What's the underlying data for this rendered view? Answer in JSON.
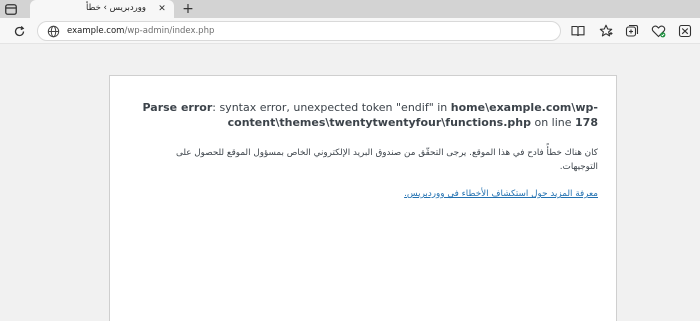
{
  "tab": {
    "title": "ووردبريس › خطأ",
    "close_glyph": "✕",
    "new_tab_glyph": "+"
  },
  "toolbar": {
    "url_host": "example.com",
    "url_path": "/wp-admin/index.php"
  },
  "error": {
    "label": "Parse error",
    "message_pre": ": syntax error, unexpected token \"endif\" in ",
    "file_part1": "home\\example.com\\wp-",
    "file_part2": "content\\themes\\twentytwentyfour\\functions.php",
    "on_line_text": " on line ",
    "line_number": "178"
  },
  "message": {
    "line1": "كان هناك خطأً فادح في هذا الموقع. يرجى التحقّق من صندوق البريد الإلكتروني الخاص بمسؤول الموقع للحصول على",
    "line2": "التوجيهات.",
    "link_text": "معرفة المزيد حول استكشاف الأخطاء في ووردبريس."
  },
  "icons": {
    "tab_actions": "tab-actions-icon",
    "refresh": "refresh-icon",
    "site_info": "globe-icon",
    "reading_view": "reading-view-icon",
    "favorites": "star-icon",
    "collections": "collections-icon",
    "extension": "extension-icon",
    "browser_essentials": "heart-pulse-icon",
    "favorites_hub": "favorites-hub-icon"
  }
}
